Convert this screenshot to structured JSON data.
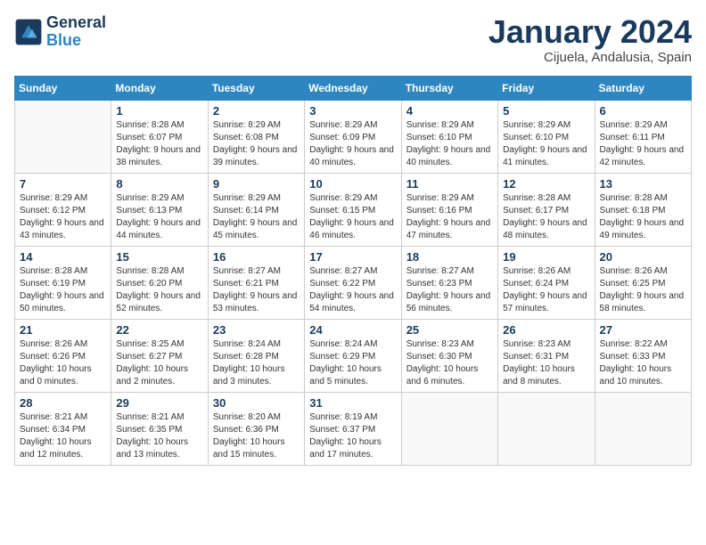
{
  "header": {
    "logo_line1": "General",
    "logo_line2": "Blue",
    "month": "January 2024",
    "location": "Cijuela, Andalusia, Spain"
  },
  "weekdays": [
    "Sunday",
    "Monday",
    "Tuesday",
    "Wednesday",
    "Thursday",
    "Friday",
    "Saturday"
  ],
  "weeks": [
    [
      {
        "day": "",
        "sunrise": "",
        "sunset": "",
        "daylight": ""
      },
      {
        "day": "1",
        "sunrise": "Sunrise: 8:28 AM",
        "sunset": "Sunset: 6:07 PM",
        "daylight": "Daylight: 9 hours and 38 minutes."
      },
      {
        "day": "2",
        "sunrise": "Sunrise: 8:29 AM",
        "sunset": "Sunset: 6:08 PM",
        "daylight": "Daylight: 9 hours and 39 minutes."
      },
      {
        "day": "3",
        "sunrise": "Sunrise: 8:29 AM",
        "sunset": "Sunset: 6:09 PM",
        "daylight": "Daylight: 9 hours and 40 minutes."
      },
      {
        "day": "4",
        "sunrise": "Sunrise: 8:29 AM",
        "sunset": "Sunset: 6:10 PM",
        "daylight": "Daylight: 9 hours and 40 minutes."
      },
      {
        "day": "5",
        "sunrise": "Sunrise: 8:29 AM",
        "sunset": "Sunset: 6:10 PM",
        "daylight": "Daylight: 9 hours and 41 minutes."
      },
      {
        "day": "6",
        "sunrise": "Sunrise: 8:29 AM",
        "sunset": "Sunset: 6:11 PM",
        "daylight": "Daylight: 9 hours and 42 minutes."
      }
    ],
    [
      {
        "day": "7",
        "sunrise": "Sunrise: 8:29 AM",
        "sunset": "Sunset: 6:12 PM",
        "daylight": "Daylight: 9 hours and 43 minutes."
      },
      {
        "day": "8",
        "sunrise": "Sunrise: 8:29 AM",
        "sunset": "Sunset: 6:13 PM",
        "daylight": "Daylight: 9 hours and 44 minutes."
      },
      {
        "day": "9",
        "sunrise": "Sunrise: 8:29 AM",
        "sunset": "Sunset: 6:14 PM",
        "daylight": "Daylight: 9 hours and 45 minutes."
      },
      {
        "day": "10",
        "sunrise": "Sunrise: 8:29 AM",
        "sunset": "Sunset: 6:15 PM",
        "daylight": "Daylight: 9 hours and 46 minutes."
      },
      {
        "day": "11",
        "sunrise": "Sunrise: 8:29 AM",
        "sunset": "Sunset: 6:16 PM",
        "daylight": "Daylight: 9 hours and 47 minutes."
      },
      {
        "day": "12",
        "sunrise": "Sunrise: 8:28 AM",
        "sunset": "Sunset: 6:17 PM",
        "daylight": "Daylight: 9 hours and 48 minutes."
      },
      {
        "day": "13",
        "sunrise": "Sunrise: 8:28 AM",
        "sunset": "Sunset: 6:18 PM",
        "daylight": "Daylight: 9 hours and 49 minutes."
      }
    ],
    [
      {
        "day": "14",
        "sunrise": "Sunrise: 8:28 AM",
        "sunset": "Sunset: 6:19 PM",
        "daylight": "Daylight: 9 hours and 50 minutes."
      },
      {
        "day": "15",
        "sunrise": "Sunrise: 8:28 AM",
        "sunset": "Sunset: 6:20 PM",
        "daylight": "Daylight: 9 hours and 52 minutes."
      },
      {
        "day": "16",
        "sunrise": "Sunrise: 8:27 AM",
        "sunset": "Sunset: 6:21 PM",
        "daylight": "Daylight: 9 hours and 53 minutes."
      },
      {
        "day": "17",
        "sunrise": "Sunrise: 8:27 AM",
        "sunset": "Sunset: 6:22 PM",
        "daylight": "Daylight: 9 hours and 54 minutes."
      },
      {
        "day": "18",
        "sunrise": "Sunrise: 8:27 AM",
        "sunset": "Sunset: 6:23 PM",
        "daylight": "Daylight: 9 hours and 56 minutes."
      },
      {
        "day": "19",
        "sunrise": "Sunrise: 8:26 AM",
        "sunset": "Sunset: 6:24 PM",
        "daylight": "Daylight: 9 hours and 57 minutes."
      },
      {
        "day": "20",
        "sunrise": "Sunrise: 8:26 AM",
        "sunset": "Sunset: 6:25 PM",
        "daylight": "Daylight: 9 hours and 58 minutes."
      }
    ],
    [
      {
        "day": "21",
        "sunrise": "Sunrise: 8:26 AM",
        "sunset": "Sunset: 6:26 PM",
        "daylight": "Daylight: 10 hours and 0 minutes."
      },
      {
        "day": "22",
        "sunrise": "Sunrise: 8:25 AM",
        "sunset": "Sunset: 6:27 PM",
        "daylight": "Daylight: 10 hours and 2 minutes."
      },
      {
        "day": "23",
        "sunrise": "Sunrise: 8:24 AM",
        "sunset": "Sunset: 6:28 PM",
        "daylight": "Daylight: 10 hours and 3 minutes."
      },
      {
        "day": "24",
        "sunrise": "Sunrise: 8:24 AM",
        "sunset": "Sunset: 6:29 PM",
        "daylight": "Daylight: 10 hours and 5 minutes."
      },
      {
        "day": "25",
        "sunrise": "Sunrise: 8:23 AM",
        "sunset": "Sunset: 6:30 PM",
        "daylight": "Daylight: 10 hours and 6 minutes."
      },
      {
        "day": "26",
        "sunrise": "Sunrise: 8:23 AM",
        "sunset": "Sunset: 6:31 PM",
        "daylight": "Daylight: 10 hours and 8 minutes."
      },
      {
        "day": "27",
        "sunrise": "Sunrise: 8:22 AM",
        "sunset": "Sunset: 6:33 PM",
        "daylight": "Daylight: 10 hours and 10 minutes."
      }
    ],
    [
      {
        "day": "28",
        "sunrise": "Sunrise: 8:21 AM",
        "sunset": "Sunset: 6:34 PM",
        "daylight": "Daylight: 10 hours and 12 minutes."
      },
      {
        "day": "29",
        "sunrise": "Sunrise: 8:21 AM",
        "sunset": "Sunset: 6:35 PM",
        "daylight": "Daylight: 10 hours and 13 minutes."
      },
      {
        "day": "30",
        "sunrise": "Sunrise: 8:20 AM",
        "sunset": "Sunset: 6:36 PM",
        "daylight": "Daylight: 10 hours and 15 minutes."
      },
      {
        "day": "31",
        "sunrise": "Sunrise: 8:19 AM",
        "sunset": "Sunset: 6:37 PM",
        "daylight": "Daylight: 10 hours and 17 minutes."
      },
      {
        "day": "",
        "sunrise": "",
        "sunset": "",
        "daylight": ""
      },
      {
        "day": "",
        "sunrise": "",
        "sunset": "",
        "daylight": ""
      },
      {
        "day": "",
        "sunrise": "",
        "sunset": "",
        "daylight": ""
      }
    ]
  ]
}
